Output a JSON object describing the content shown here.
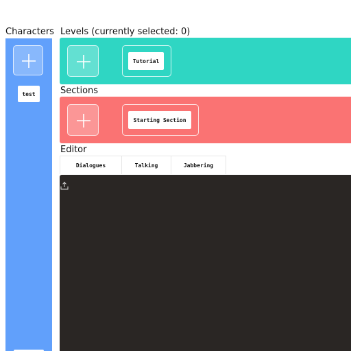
{
  "characters": {
    "title": "Characters",
    "add_icon": "plus-icon",
    "items": [
      {
        "label": "test"
      }
    ]
  },
  "levels": {
    "title": "Levels (currently selected: 0)",
    "color": "#2fd6c3",
    "add_icon": "plus-icon",
    "items": [
      {
        "label": "Tutorial"
      }
    ]
  },
  "sections": {
    "title": "Sections",
    "color": "#fa7373",
    "add_icon": "plus-icon",
    "items": [
      {
        "label": "Starting Section"
      }
    ]
  },
  "editor": {
    "title": "Editor",
    "tabs": [
      {
        "label": "Dialogues"
      },
      {
        "label": "Talking"
      },
      {
        "label": "Jabbering"
      }
    ],
    "upload_icon": "upload-icon",
    "background": "#2a2624"
  },
  "colors": {
    "characters_panel": "#61a0fb"
  }
}
